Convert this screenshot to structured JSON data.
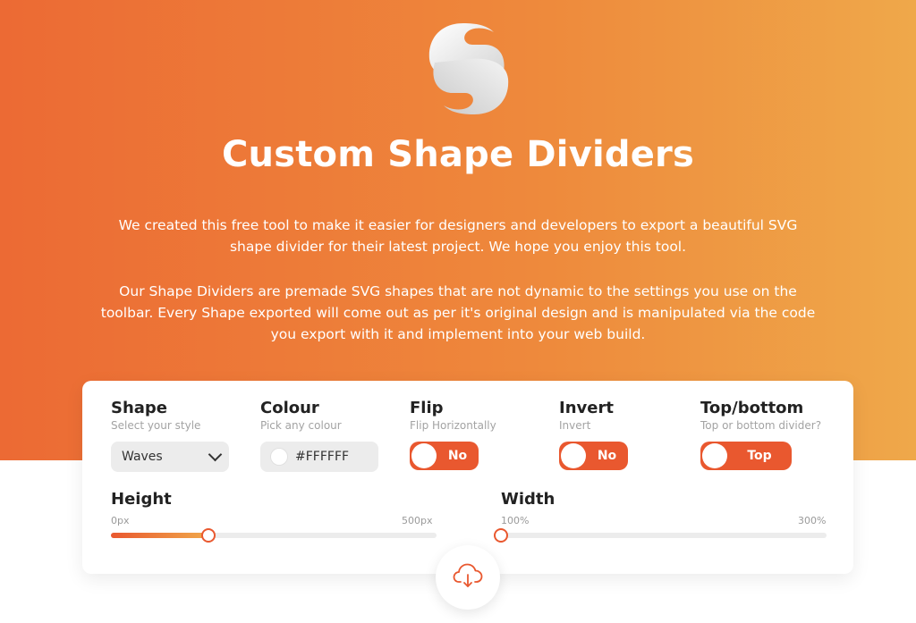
{
  "header": {
    "title": "Custom Shape Dividers",
    "intro_1": "We created this free tool to make it easier for designers and developers to export a beautiful SVG shape divider for their latest project. We hope you enjoy this tool.",
    "intro_2": "Our Shape Dividers are premade SVG shapes that are not dynamic to the settings you use on the toolbar. Every Shape exported will come out as per it's original design and is manipulated via the code you export with it and implement into your web build."
  },
  "controls": {
    "shape": {
      "label": "Shape",
      "sub": "Select your style",
      "value": "Waves"
    },
    "colour": {
      "label": "Colour",
      "sub": "Pick any colour",
      "value": "#FFFFFF"
    },
    "flip": {
      "label": "Flip",
      "sub": "Flip Horizontally",
      "value": "No"
    },
    "invert": {
      "label": "Invert",
      "sub": "Invert",
      "value": "No"
    },
    "position": {
      "label": "Top/bottom",
      "sub": "Top or bottom divider?",
      "value": "Top"
    }
  },
  "sliders": {
    "height": {
      "label": "Height",
      "min": "0px",
      "max": "500px",
      "level": 0.3
    },
    "width": {
      "label": "Width",
      "min": "100%",
      "max": "300%",
      "level": 0.0
    }
  },
  "colors": {
    "accent": "#e9582f",
    "gradient_start": "#ec6a34",
    "gradient_end": "#efa84a"
  },
  "icons": {
    "logo": "stacked-s-logo",
    "download": "cloud-download-icon"
  }
}
